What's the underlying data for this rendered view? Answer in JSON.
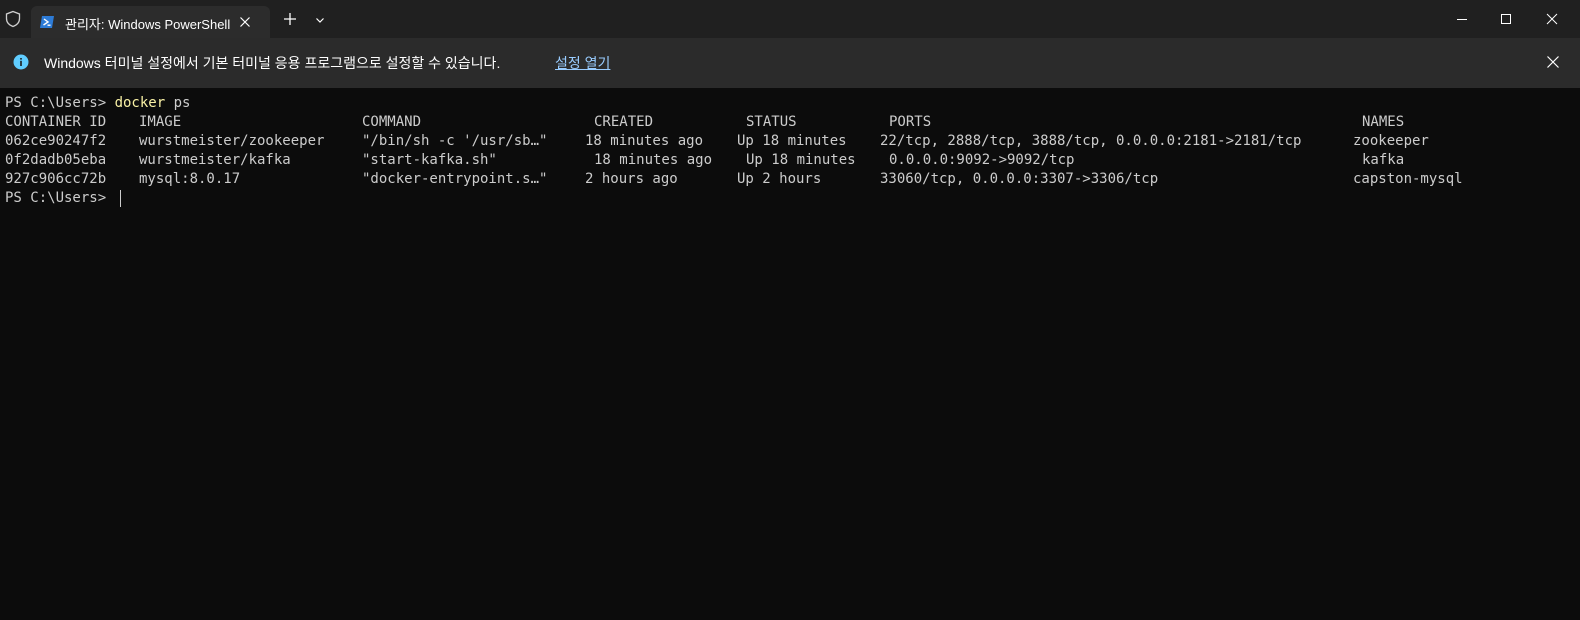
{
  "tab": {
    "title": "관리자: Windows PowerShell"
  },
  "infobar": {
    "message": "Windows 터미널 설정에서 기본 터미널 응용 프로그램으로 설정할 수 있습니다.",
    "link": "설정 열기"
  },
  "terminal": {
    "prompt": "PS C:\\Users> ",
    "command_name": "docker",
    "command_args": " ps",
    "headers": [
      "CONTAINER ID",
      "IMAGE",
      "COMMAND",
      "CREATED",
      "STATUS",
      "PORTS",
      "NAMES"
    ],
    "rows": [
      [
        "062ce90247f2",
        "wurstmeister/zookeeper",
        "\"/bin/sh -c '/usr/sb…\"",
        "18 minutes ago",
        "Up 18 minutes",
        "22/tcp, 2888/tcp, 3888/tcp, 0.0.0.0:2181->2181/tcp",
        "zookeeper"
      ],
      [
        "0f2dadb05eba",
        "wurstmeister/kafka",
        "\"start-kafka.sh\"",
        "18 minutes ago",
        "Up 18 minutes",
        "0.0.0.0:9092->9092/tcp",
        "kafka"
      ],
      [
        "927c906cc72b",
        "mysql:8.0.17",
        "\"docker-entrypoint.s…\"",
        "2 hours ago",
        "Up 2 hours",
        "33060/tcp, 0.0.0.0:3307->3306/tcp",
        "capston-mysql"
      ]
    ],
    "final_prompt": "PS C:\\Users> "
  },
  "icons": {
    "shield": "shield-icon",
    "tab": "powershell-icon",
    "tab_close": "close-icon",
    "new_tab": "plus-icon",
    "dropdown": "chevron-down-icon",
    "minimize": "minimize-icon",
    "maximize": "maximize-icon",
    "close": "close-icon",
    "info": "info-icon"
  },
  "colors": {
    "background": "#0c0c0c",
    "titlebar": "#202020",
    "tab": "#2c2c2c",
    "infobar": "#2b2b2b",
    "text": "#cccccc",
    "command": "#f9f1a5",
    "link": "#99ccff",
    "info_icon": "#60cdff"
  }
}
